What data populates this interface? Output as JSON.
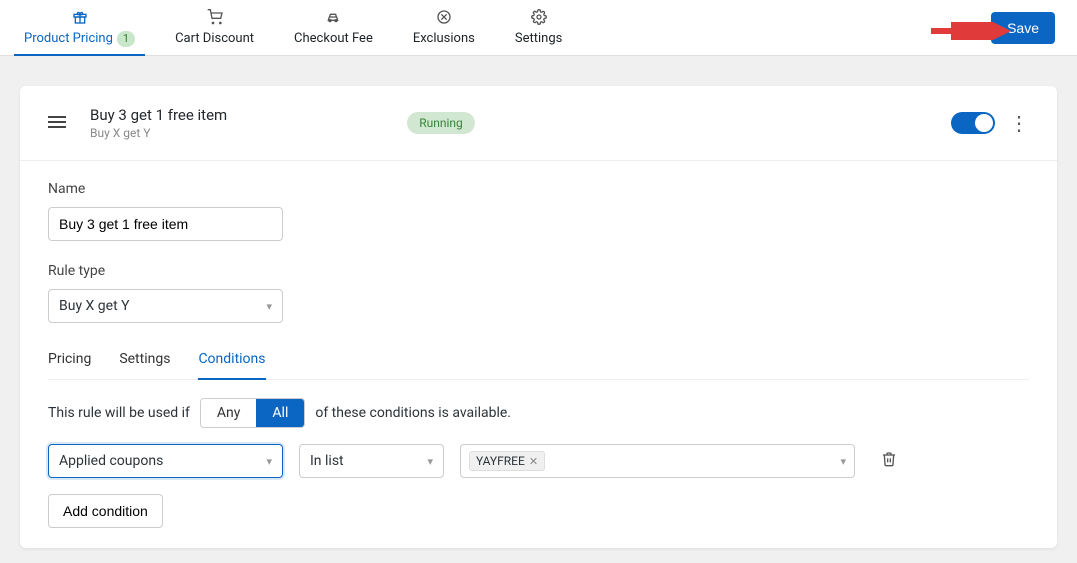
{
  "topTabs": {
    "productPricing": {
      "label": "Product Pricing",
      "count": "1"
    },
    "cartDiscount": {
      "label": "Cart Discount"
    },
    "checkoutFee": {
      "label": "Checkout Fee"
    },
    "exclusions": {
      "label": "Exclusions"
    },
    "settings": {
      "label": "Settings"
    }
  },
  "actions": {
    "save": "Save"
  },
  "rule": {
    "title": "Buy 3 get 1 free item",
    "subtitle": "Buy X get Y",
    "status": "Running"
  },
  "form": {
    "nameLabel": "Name",
    "nameValue": "Buy 3 get 1 free item",
    "ruleTypeLabel": "Rule type",
    "ruleTypeValue": "Buy X get Y"
  },
  "subtabs": {
    "pricing": "Pricing",
    "settings": "Settings",
    "conditions": "Conditions"
  },
  "conditions": {
    "prefix": "This rule will be used if",
    "any": "Any",
    "all": "All",
    "suffix": "of these conditions is available.",
    "fieldSelect": "Applied coupons",
    "opSelect": "In list",
    "tag": "YAYFREE",
    "addBtn": "Add condition"
  }
}
